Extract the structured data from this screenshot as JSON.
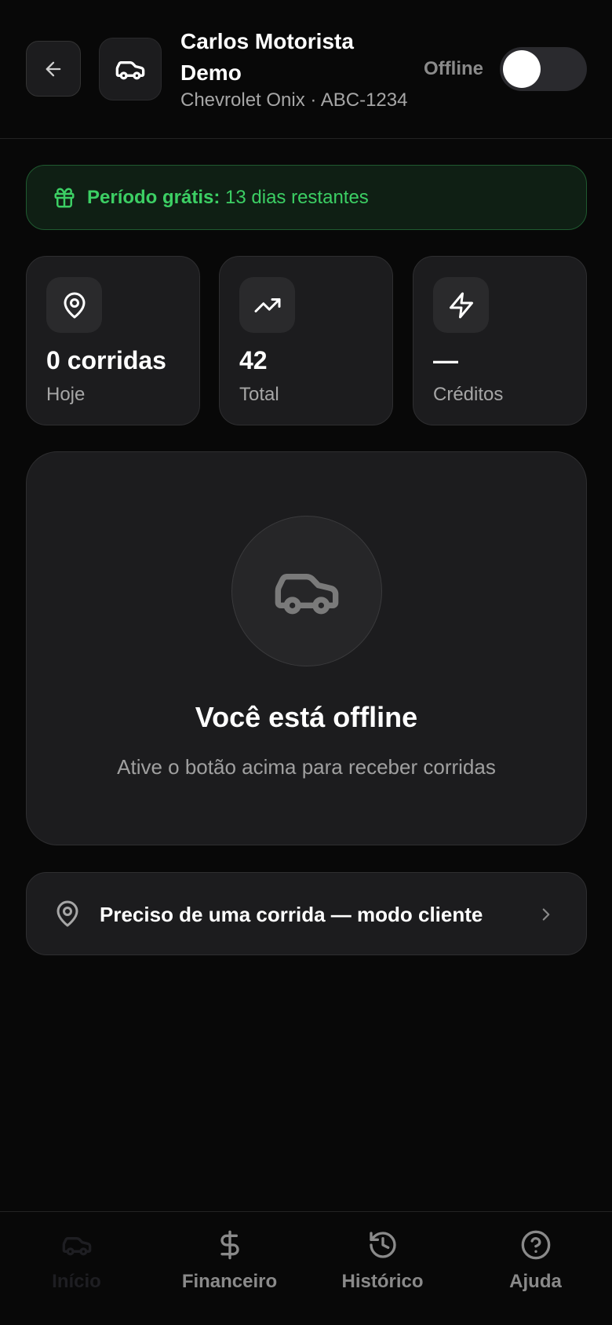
{
  "header": {
    "back_icon": "arrow-left-icon",
    "avatar_icon": "car-icon",
    "driver_name": "Carlos Motorista Demo",
    "vehicle": "Chevrolet Onix · ABC-1234",
    "status_label": "Offline",
    "online": false
  },
  "trial": {
    "icon": "gift-icon",
    "label": "Período grátis:",
    "value": "13 dias restantes",
    "color": "#3ccf64"
  },
  "stats": [
    {
      "icon": "map-pin-icon",
      "value": "0 corridas",
      "label": "Hoje"
    },
    {
      "icon": "trending-up-icon",
      "value": "42",
      "label": "Total"
    },
    {
      "icon": "zap-icon",
      "value": "—",
      "label": "Créditos"
    }
  ],
  "offline_card": {
    "icon": "car-icon",
    "title": "Você está offline",
    "subtitle": "Ative o botão acima para receber corridas"
  },
  "client_mode": {
    "icon": "map-pin-icon",
    "label": "Preciso de uma corrida — modo cliente"
  },
  "nav": {
    "items": [
      {
        "icon": "car-icon",
        "label": "Início",
        "active": true
      },
      {
        "icon": "dollar-sign-icon",
        "label": "Financeiro",
        "active": false
      },
      {
        "icon": "history-icon",
        "label": "Histórico",
        "active": false
      },
      {
        "icon": "help-circle-icon",
        "label": "Ajuda",
        "active": false
      }
    ]
  }
}
